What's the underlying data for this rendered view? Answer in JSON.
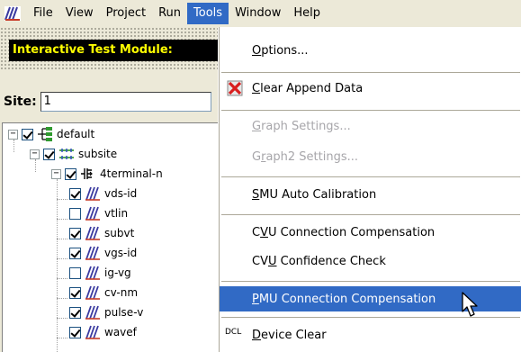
{
  "menubar": {
    "items": [
      {
        "label": "File"
      },
      {
        "label": "View"
      },
      {
        "label": "Project"
      },
      {
        "label": "Run"
      },
      {
        "label": "Tools"
      },
      {
        "label": "Window"
      },
      {
        "label": "Help"
      }
    ]
  },
  "banner": {
    "text": "Interactive Test Module:"
  },
  "site": {
    "label": "Site:",
    "value": "1"
  },
  "tree": {
    "nodes": [
      {
        "label": "default"
      },
      {
        "label": "subsite"
      },
      {
        "label": "4terminal-n"
      },
      {
        "label": "vds-id"
      },
      {
        "label": "vtlin"
      },
      {
        "label": "subvt"
      },
      {
        "label": "vgs-id"
      },
      {
        "label": "ig-vg"
      },
      {
        "label": "cv-nm"
      },
      {
        "label": "pulse-v"
      },
      {
        "label": "wavef"
      }
    ]
  },
  "tools_menu": {
    "items": [
      {
        "pre": "",
        "u": "O",
        "post": "ptions..."
      },
      {
        "pre": "",
        "u": "C",
        "post": "lear Append Data"
      },
      {
        "pre": "",
        "u": "G",
        "post": "raph Settings..."
      },
      {
        "pre": "G",
        "u": "r",
        "post": "aph2 Settings..."
      },
      {
        "pre": "",
        "u": "S",
        "post": "MU Auto Calibration"
      },
      {
        "pre": "C",
        "u": "V",
        "post": "U Connection Compensation"
      },
      {
        "pre": "CV",
        "u": "U",
        "post": " Confidence Check"
      },
      {
        "pre": "",
        "u": "P",
        "post": "MU Connection Compensation"
      },
      {
        "pre": "",
        "u": "D",
        "post": "evice Clear"
      }
    ],
    "device_clear_icon_text": "DCL"
  },
  "colors": {
    "menu_highlight": "#316ac5",
    "banner_bg": "#000000",
    "banner_text": "#ffff00",
    "disabled_text": "#a7a6aa"
  },
  "icons": [
    "app-logo-icon",
    "clear-x-icon",
    "device-clear-icon",
    "pointer-cursor-icon",
    "test-module-icon",
    "device-icon",
    "subsite-icon",
    "site-icon"
  ]
}
